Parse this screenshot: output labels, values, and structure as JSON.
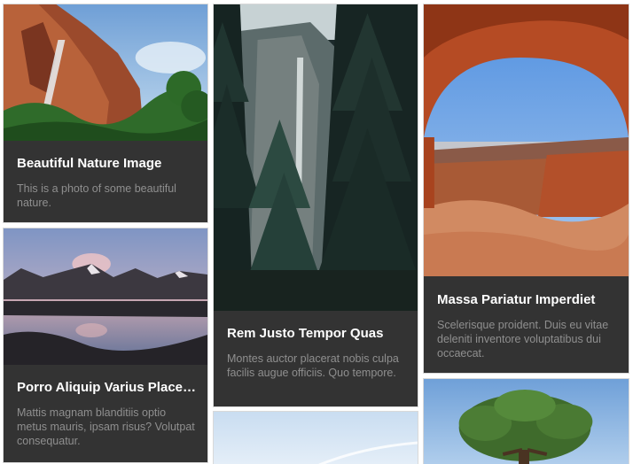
{
  "cards": [
    {
      "image": "waterfall-cliff-photo",
      "title": "Beautiful Nature Image",
      "description": "This is a photo of some beautiful nature."
    },
    {
      "image": "forest-waterfall-photo",
      "title": "Rem Justo Tempor Quas",
      "description": "Montes auctor placerat nobis culpa facilis augue officiis. Quo tempore."
    },
    {
      "image": "desert-arch-photo",
      "title": "Massa Pariatur Imperdiet",
      "description": "Scelerisque proident. Duis eu vitae deleniti inventore voluptatibus dui occaecat."
    },
    {
      "image": "mountain-lake-photo",
      "title": "Porro Aliquip Varius Placerat",
      "description": "Mattis magnam blanditiis optio metus mauris, ipsam risus? Volutpat consequatur."
    },
    {
      "image": "sky-photo"
    },
    {
      "image": "tree-photo"
    }
  ],
  "colors": {
    "card_background": "#333333",
    "title": "#ffffff",
    "description": "#8f8f8f"
  }
}
